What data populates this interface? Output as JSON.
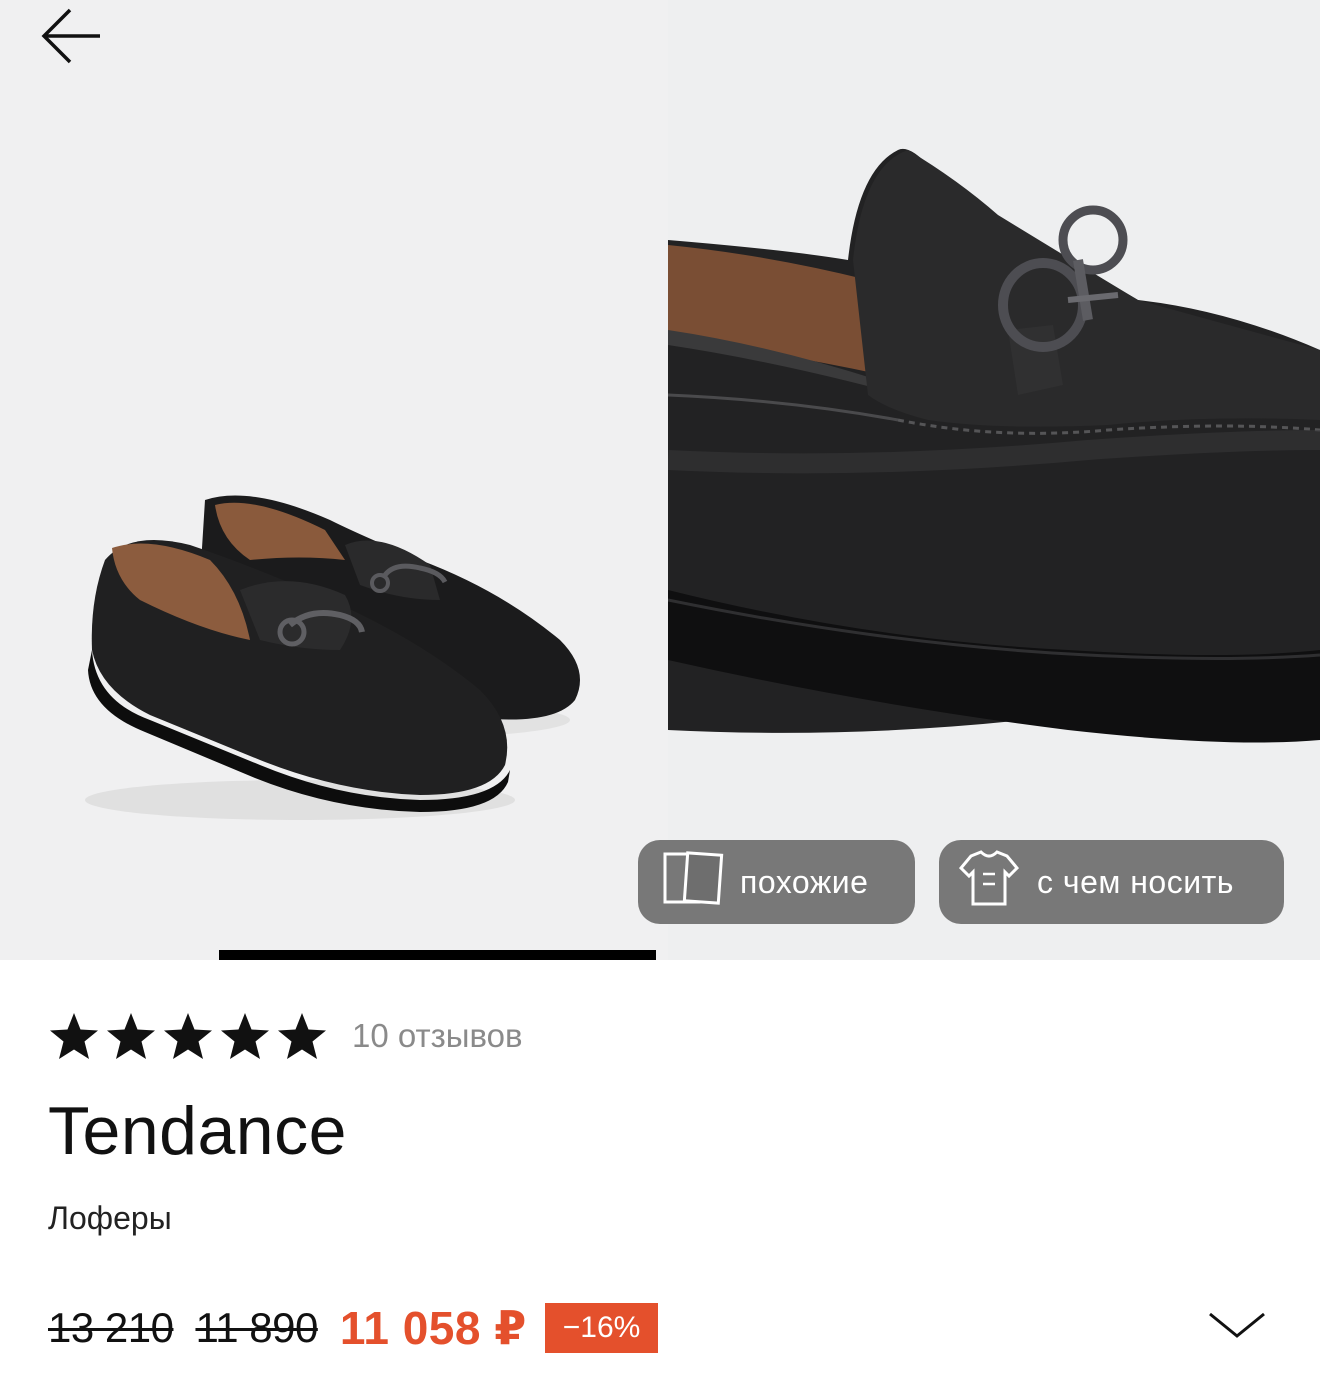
{
  "gallery": {
    "photo_1_alt": "",
    "photo_2_alt": "",
    "similar_label": "похожие",
    "wear_label": "с чем носить"
  },
  "rating": {
    "stars": 5,
    "reviews_label": "10 отзывов"
  },
  "product": {
    "brand": "Tendance",
    "category": "Лоферы"
  },
  "price": {
    "old_price_1": "13 210",
    "old_price_2": "11 890",
    "current": "11 058 ₽",
    "discount": "−16%"
  },
  "colors": {
    "accent": "#e4502c",
    "overlay_button": "#6e6e6e",
    "gallery_bg": "#f0f0f1"
  },
  "icons": {
    "back": "arrow-left-icon",
    "similar": "cards-icon",
    "wear": "tshirt-icon",
    "expand": "chevron-down-icon",
    "star": "star-icon"
  }
}
